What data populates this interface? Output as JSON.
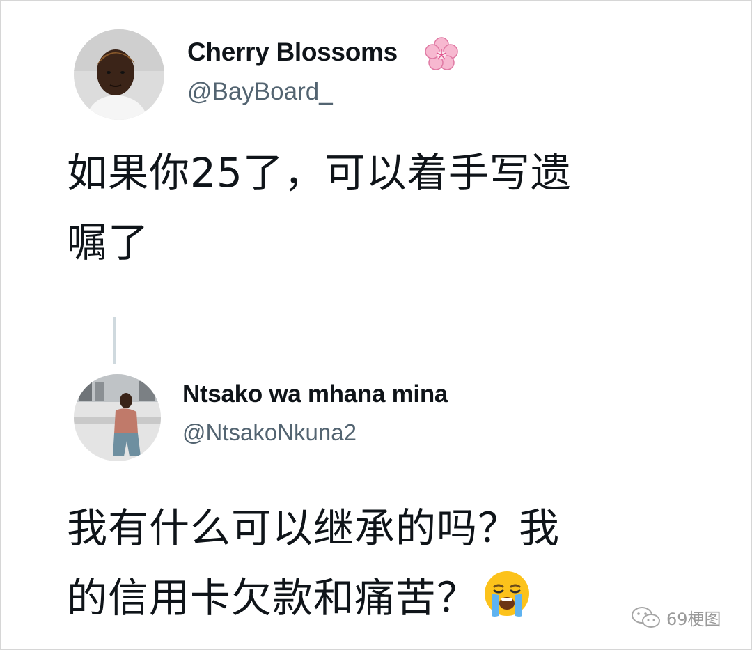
{
  "tweet1": {
    "display_name": "Cherry Blossoms",
    "handle": "@BayBoard_",
    "name_emoji": "cherry-blossom-icon",
    "text_lines": [
      "如果你25了，可以着手写遗",
      "嘱了"
    ]
  },
  "tweet2": {
    "display_name": "Ntsako wa mhana mina",
    "handle": "@NtsakoNkuna2",
    "text_lines": [
      "我有什么可以继承的吗？我",
      "的信用卡欠款和痛苦？"
    ],
    "trailing_emoji": "crying-face-icon"
  },
  "watermark": {
    "text": "69梗图",
    "icon": "wechat-icon"
  },
  "colors": {
    "text": "#0f1419",
    "handle": "#536471",
    "thread_line": "#cfd9de",
    "watermark": "#9a9a9a"
  }
}
